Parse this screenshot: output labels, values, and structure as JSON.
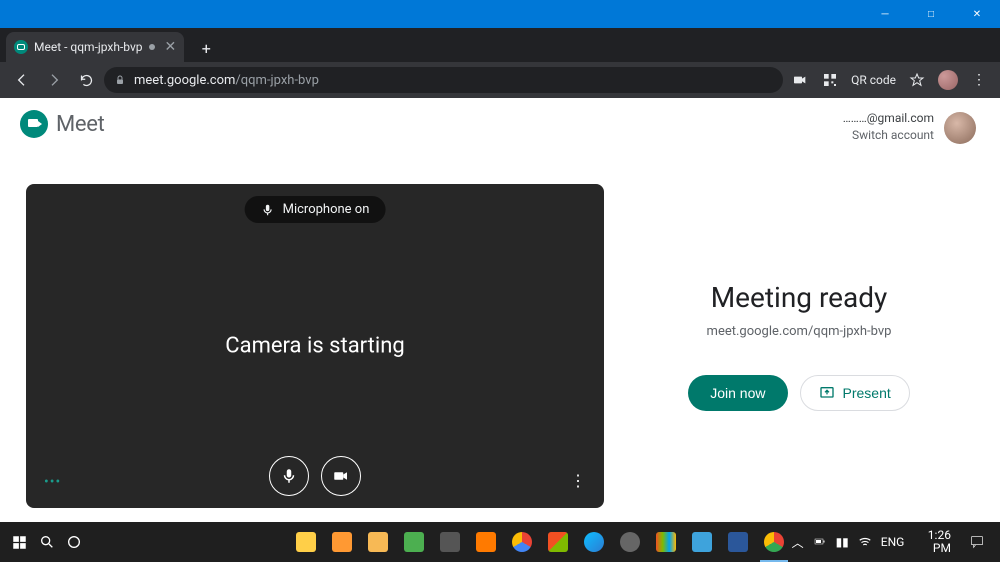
{
  "window": {
    "minimize": "─",
    "maximize": "□",
    "close": "✕"
  },
  "browser": {
    "tab_title": "Meet - qqm-jpxh-bvp",
    "newtab": "+",
    "tab_close": "✕",
    "url_domain": "meet.google.com",
    "url_path": "/qqm-jpxh-bvp",
    "qr_label": "QR code"
  },
  "header": {
    "app_name": "Meet",
    "email": "………@gmail.com",
    "switch": "Switch account"
  },
  "preview": {
    "mic_label": "Microphone on",
    "center": "Camera is starting"
  },
  "right": {
    "title": "Meeting ready",
    "url": "meet.google.com/qqm-jpxh-bvp",
    "join": "Join now",
    "present": "Present"
  },
  "taskbar": {
    "lang": "ENG",
    "time": "1:26 PM"
  }
}
